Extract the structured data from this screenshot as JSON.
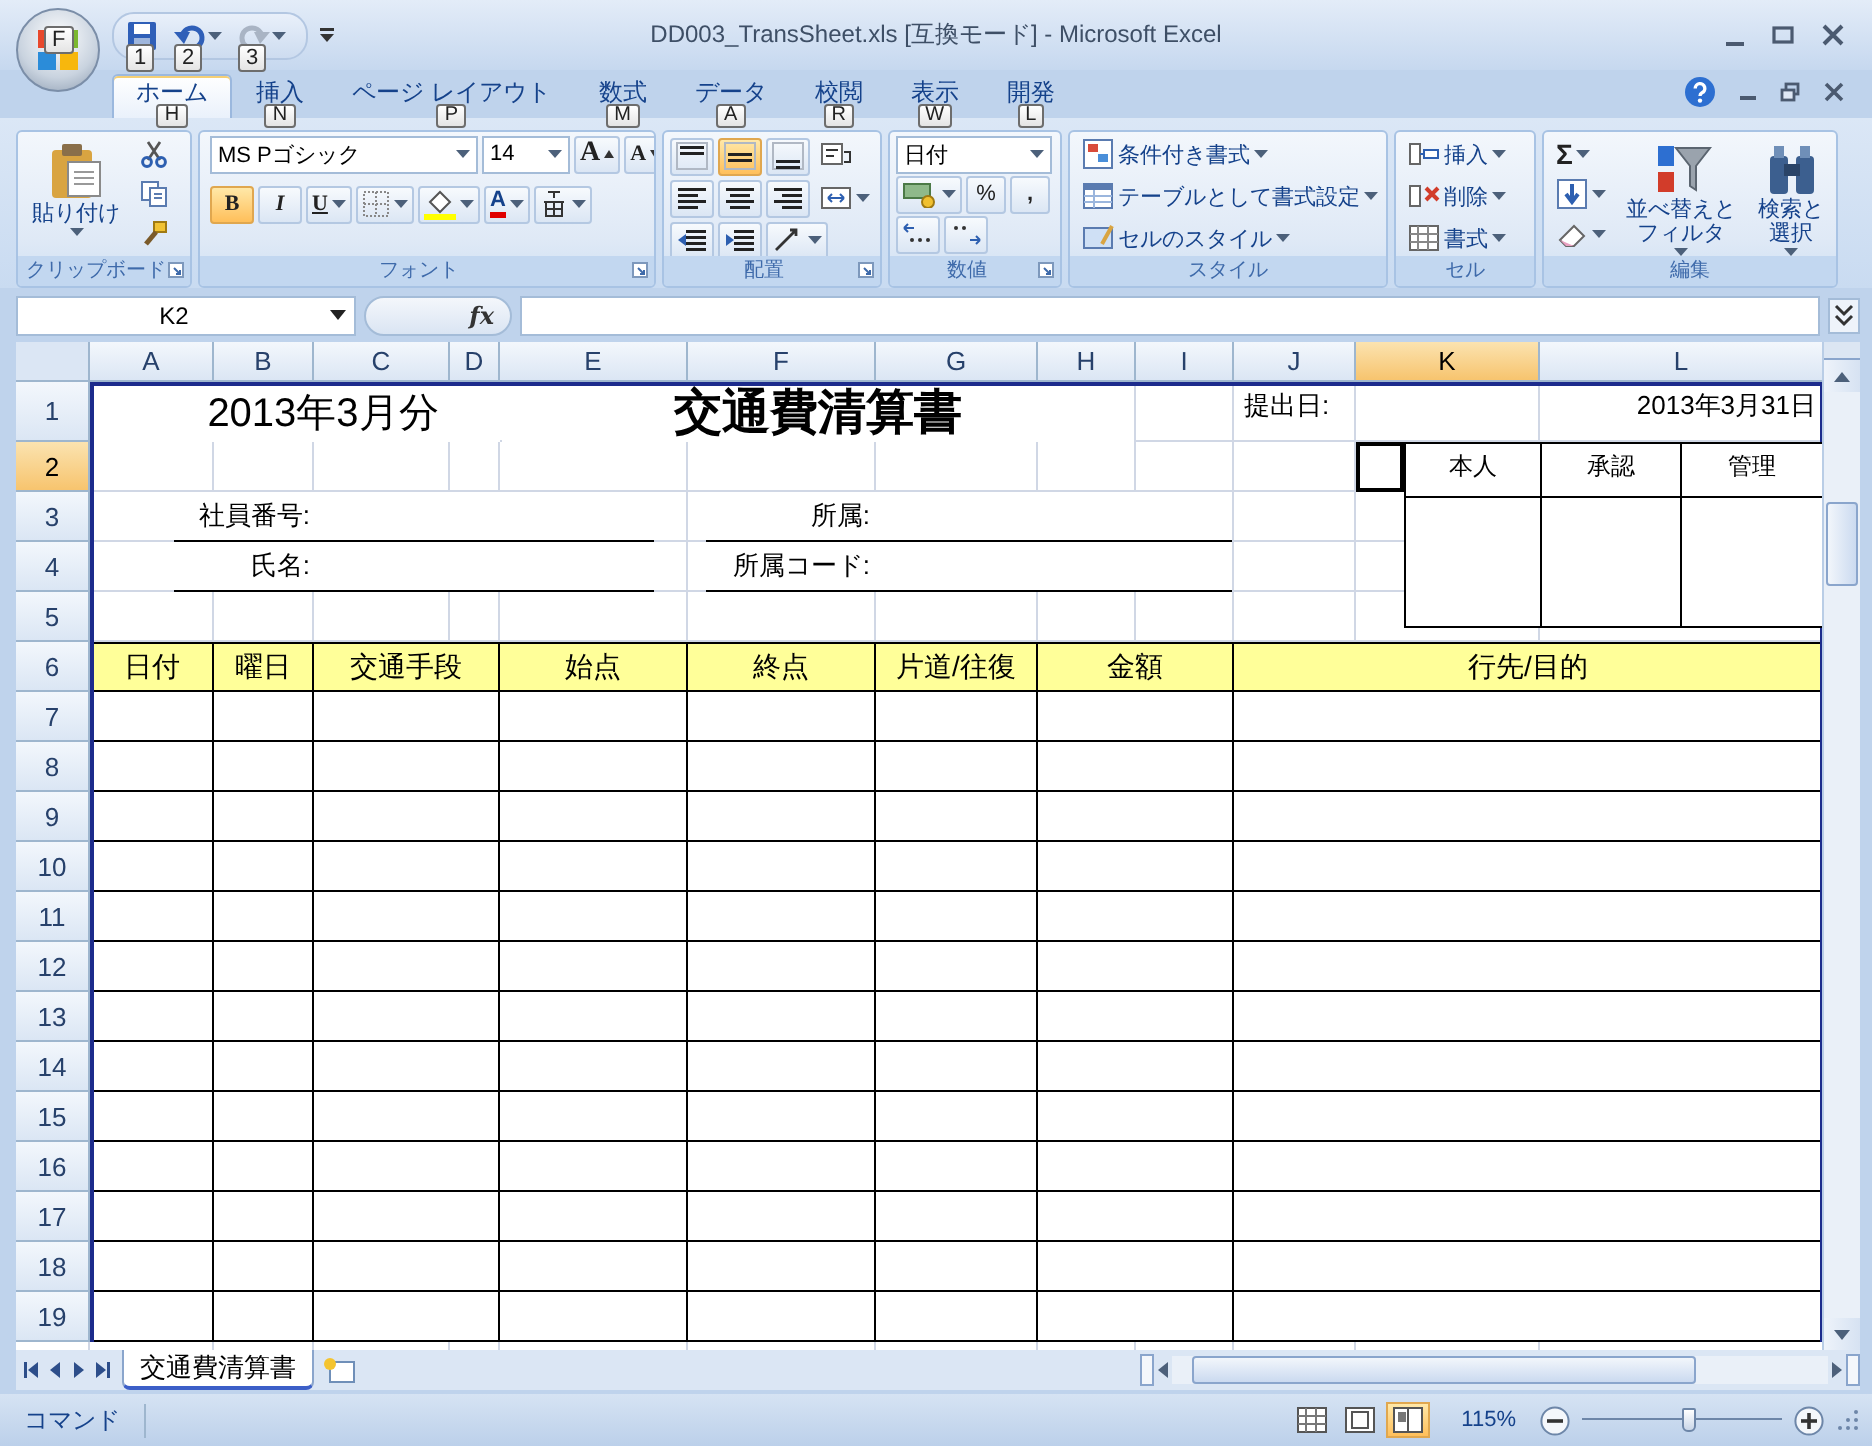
{
  "window": {
    "title": "DD003_TransSheet.xls [互換モード] - Microsoft Excel",
    "office_keytip": "F",
    "quick_access": [
      {
        "kind": "save",
        "keytip": "1",
        "disabled": false
      },
      {
        "kind": "undo",
        "keytip": "2",
        "disabled": false
      },
      {
        "kind": "redo",
        "keytip": "3",
        "disabled": true
      }
    ]
  },
  "tabs": [
    {
      "label": "ホーム",
      "keytip": "H",
      "selected": true
    },
    {
      "label": "挿入",
      "keytip": "N",
      "selected": false
    },
    {
      "label": "ページ レイアウト",
      "keytip": "P",
      "selected": false
    },
    {
      "label": "数式",
      "keytip": "M",
      "selected": false
    },
    {
      "label": "データ",
      "keytip": "A",
      "selected": false
    },
    {
      "label": "校閲",
      "keytip": "R",
      "selected": false
    },
    {
      "label": "表示",
      "keytip": "W",
      "selected": false
    },
    {
      "label": "開発",
      "keytip": "L",
      "selected": false
    }
  ],
  "ribbon": {
    "clipboard": {
      "label": "クリップボード",
      "paste": "貼り付け"
    },
    "font": {
      "label": "フォント",
      "name": "MS Pゴシック",
      "size": "14",
      "grow": "A",
      "shrink": "A",
      "bold_text": "B",
      "bold": true,
      "italic": "I",
      "underline": "U",
      "color_text": "A"
    },
    "alignment": {
      "label": "配置",
      "vertical": [
        {
          "kind": "top",
          "selected": false
        },
        {
          "kind": "middle",
          "selected": true
        },
        {
          "kind": "bottom",
          "selected": false
        }
      ]
    },
    "number": {
      "label": "数値",
      "format": "日付",
      "percent": "%",
      "comma": ","
    },
    "styles": {
      "label": "スタイル",
      "items": [
        {
          "kind": "conditional",
          "label": "条件付き書式"
        },
        {
          "kind": "table",
          "label": "テーブルとして書式設定"
        },
        {
          "kind": "cell",
          "label": "セルのスタイル"
        }
      ]
    },
    "cells": {
      "label": "セル",
      "items": [
        {
          "kind": "insert",
          "label": "挿入"
        },
        {
          "kind": "delete",
          "label": "削除"
        },
        {
          "kind": "format",
          "label": "書式"
        }
      ]
    },
    "editing": {
      "label": "編集",
      "sum": "Σ",
      "sort": "並べ替えとフィルタ",
      "find": "検索と選択"
    }
  },
  "formula_bar": {
    "name_box": "K2",
    "fx": "fx"
  },
  "sheet": {
    "columns": [
      {
        "label": "A",
        "selected": false
      },
      {
        "label": "B",
        "selected": false
      },
      {
        "label": "C",
        "selected": false
      },
      {
        "label": "D",
        "selected": false
      },
      {
        "label": "E",
        "selected": false
      },
      {
        "label": "F",
        "selected": false
      },
      {
        "label": "G",
        "selected": false
      },
      {
        "label": "H",
        "selected": false
      },
      {
        "label": "I",
        "selected": false
      },
      {
        "label": "J",
        "selected": false
      },
      {
        "label": "K",
        "selected": true
      },
      {
        "label": "L",
        "selected": false
      }
    ],
    "rows": [
      {
        "label": "1",
        "selected": false
      },
      {
        "label": "2",
        "selected": true
      },
      {
        "label": "3",
        "selected": false
      },
      {
        "label": "4",
        "selected": false
      },
      {
        "label": "5",
        "selected": false
      },
      {
        "label": "6",
        "selected": false
      },
      {
        "label": "7",
        "selected": false
      },
      {
        "label": "8",
        "selected": false
      },
      {
        "label": "9",
        "selected": false
      },
      {
        "label": "10",
        "selected": false
      },
      {
        "label": "11",
        "selected": false
      },
      {
        "label": "12",
        "selected": false
      },
      {
        "label": "13",
        "selected": false
      },
      {
        "label": "14",
        "selected": false
      },
      {
        "label": "15",
        "selected": false
      },
      {
        "label": "16",
        "selected": false
      },
      {
        "label": "17",
        "selected": false
      },
      {
        "label": "18",
        "selected": false
      },
      {
        "label": "19",
        "selected": false
      }
    ],
    "period": "2013年3月分",
    "title": "交通費清算書",
    "submit_label": "提出日:",
    "submit_date": "2013年3月31日",
    "fields": [
      "社員番号:",
      "氏名:",
      "所属:",
      "所属コード:"
    ],
    "approval": [
      "本人",
      "承認",
      "管理"
    ],
    "table_columns": [
      "日付",
      "曜日",
      "交通手段",
      "始点",
      "終点",
      "片道/往復",
      "金額",
      "行先/目的"
    ]
  },
  "sheet_tabs": [
    {
      "label": "交通費清算書",
      "selected": true
    }
  ],
  "status_bar": {
    "mode": "コマンド",
    "views": [
      {
        "kind": "normal",
        "selected": false
      },
      {
        "kind": "layout",
        "selected": false
      },
      {
        "kind": "break",
        "selected": true
      }
    ],
    "zoom": "115%",
    "level": 0.53
  }
}
